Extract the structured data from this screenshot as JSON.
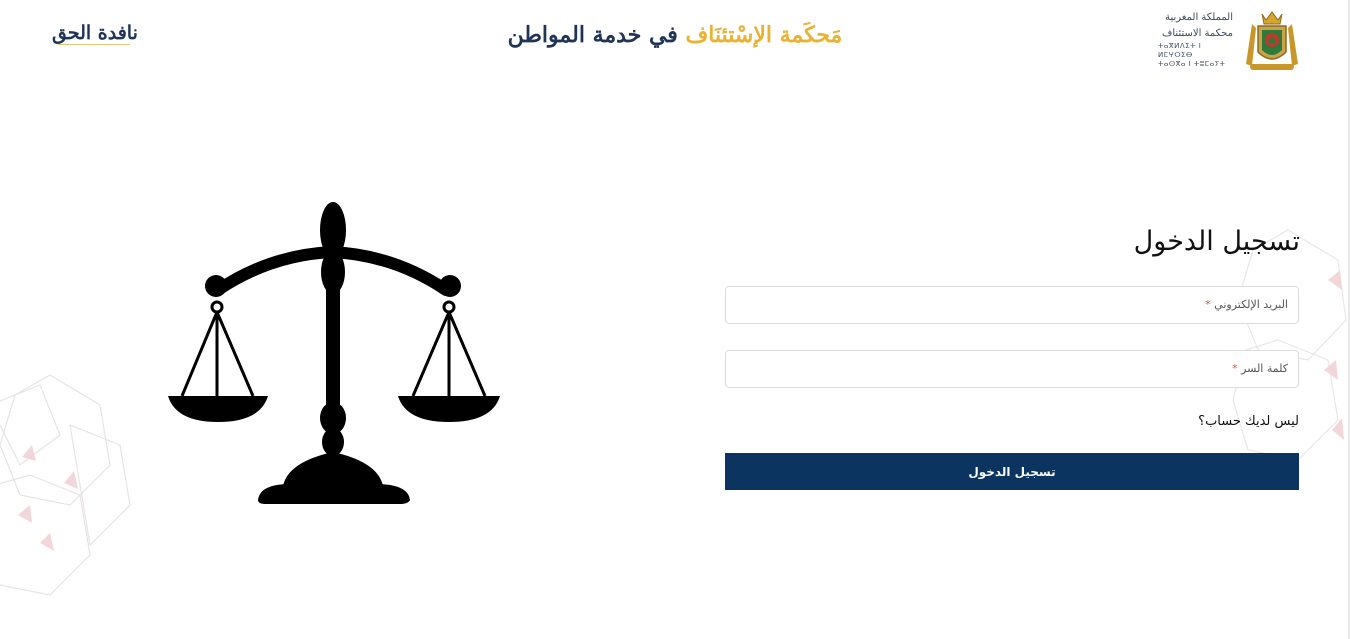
{
  "header": {
    "brand": "نافدة الحق",
    "title_part1": "مَحكَمة الإسْتئنَاف",
    "title_part2": "في خدمة المواطن",
    "logo_line1": "المملكة المغربية",
    "logo_line2": "محكمة الاستئناف",
    "logo_line3": "ⵜⴰⴳⵍⴷⵉⵜ ⵏ ⵍⵎⵖⵔⵉⴱ",
    "logo_line4": "ⵜⴰⵙⴳⴰ ⵏ ⵜⵓⵎⴰⵢⵜ"
  },
  "login": {
    "title": "تسجيل الدخول",
    "email_label": "البريد الإلكتروني",
    "password_label": "كلمة السر",
    "required_mark": "*",
    "signup_text": "ليس لديك حساب؟",
    "submit_label": "تسجيل الدخول"
  },
  "colors": {
    "primary": "#0b3560",
    "accent_gold": "#e9b233",
    "title_navy": "#1f3457",
    "required": "#d9534f"
  },
  "icons": {
    "scale": "scale-of-justice-icon",
    "emblem": "moroccan-coat-of-arms-icon"
  }
}
